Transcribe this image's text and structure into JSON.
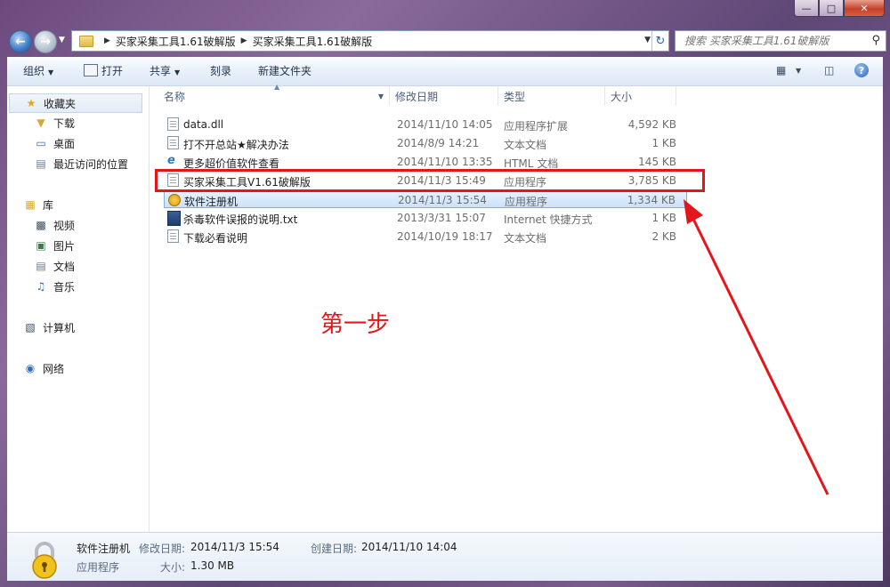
{
  "nav": {
    "breadcrumb": [
      "买家采集工具1.61破解版",
      "买家采集工具1.61破解版"
    ],
    "search_placeholder": "搜索 买家采集工具1.61破解版"
  },
  "toolbar": {
    "organize": "组织",
    "open": "打开",
    "share": "共享",
    "burn": "刻录",
    "new_folder": "新建文件夹"
  },
  "sidebar": {
    "favorites_label": "收藏夹",
    "favorites": [
      "下载",
      "桌面",
      "最近访问的位置"
    ],
    "libraries_label": "库",
    "libraries": [
      "视频",
      "图片",
      "文档",
      "音乐"
    ],
    "computer_label": "计算机",
    "network_label": "网络"
  },
  "columns": {
    "name": "名称",
    "date": "修改日期",
    "type": "类型",
    "size": "大小"
  },
  "files": [
    {
      "name": "data.dll",
      "date": "2014/11/10 14:05",
      "type": "应用程序扩展",
      "size": "4,592 KB",
      "icon": "dll-icon"
    },
    {
      "name": "打不开总站★解决办法",
      "date": "2014/8/9 14:21",
      "type": "文本文档",
      "size": "1 KB",
      "icon": "text-file-icon"
    },
    {
      "name": "更多超价值软件查看",
      "date": "2014/11/10 13:35",
      "type": "HTML 文档",
      "size": "145 KB",
      "icon": "ie-icon"
    },
    {
      "name": "买家采集工具V1.61破解版",
      "date": "2014/11/3 15:49",
      "type": "应用程序",
      "size": "3,785 KB",
      "icon": "app-icon"
    },
    {
      "name": "软件注册机",
      "date": "2014/11/3 15:54",
      "type": "应用程序",
      "size": "1,334 KB",
      "icon": "lock-app-icon"
    },
    {
      "name": "杀毒软件误报的说明.txt",
      "date": "2013/3/31 15:07",
      "type": "Internet 快捷方式",
      "size": "1 KB",
      "icon": "shortcut-icon"
    },
    {
      "name": "下载必看说明",
      "date": "2014/10/19 18:17",
      "type": "文本文档",
      "size": "2 KB",
      "icon": "text-file-icon"
    }
  ],
  "annotation": {
    "step_text": "第一步",
    "color": "#e3161b"
  },
  "details": {
    "name": "软件注册机",
    "modified_label": "修改日期:",
    "modified": "2014/11/3 15:54",
    "created_label": "创建日期:",
    "created": "2014/11/10 14:04",
    "type": "应用程序",
    "size_label": "大小:",
    "size": "1.30 MB"
  }
}
